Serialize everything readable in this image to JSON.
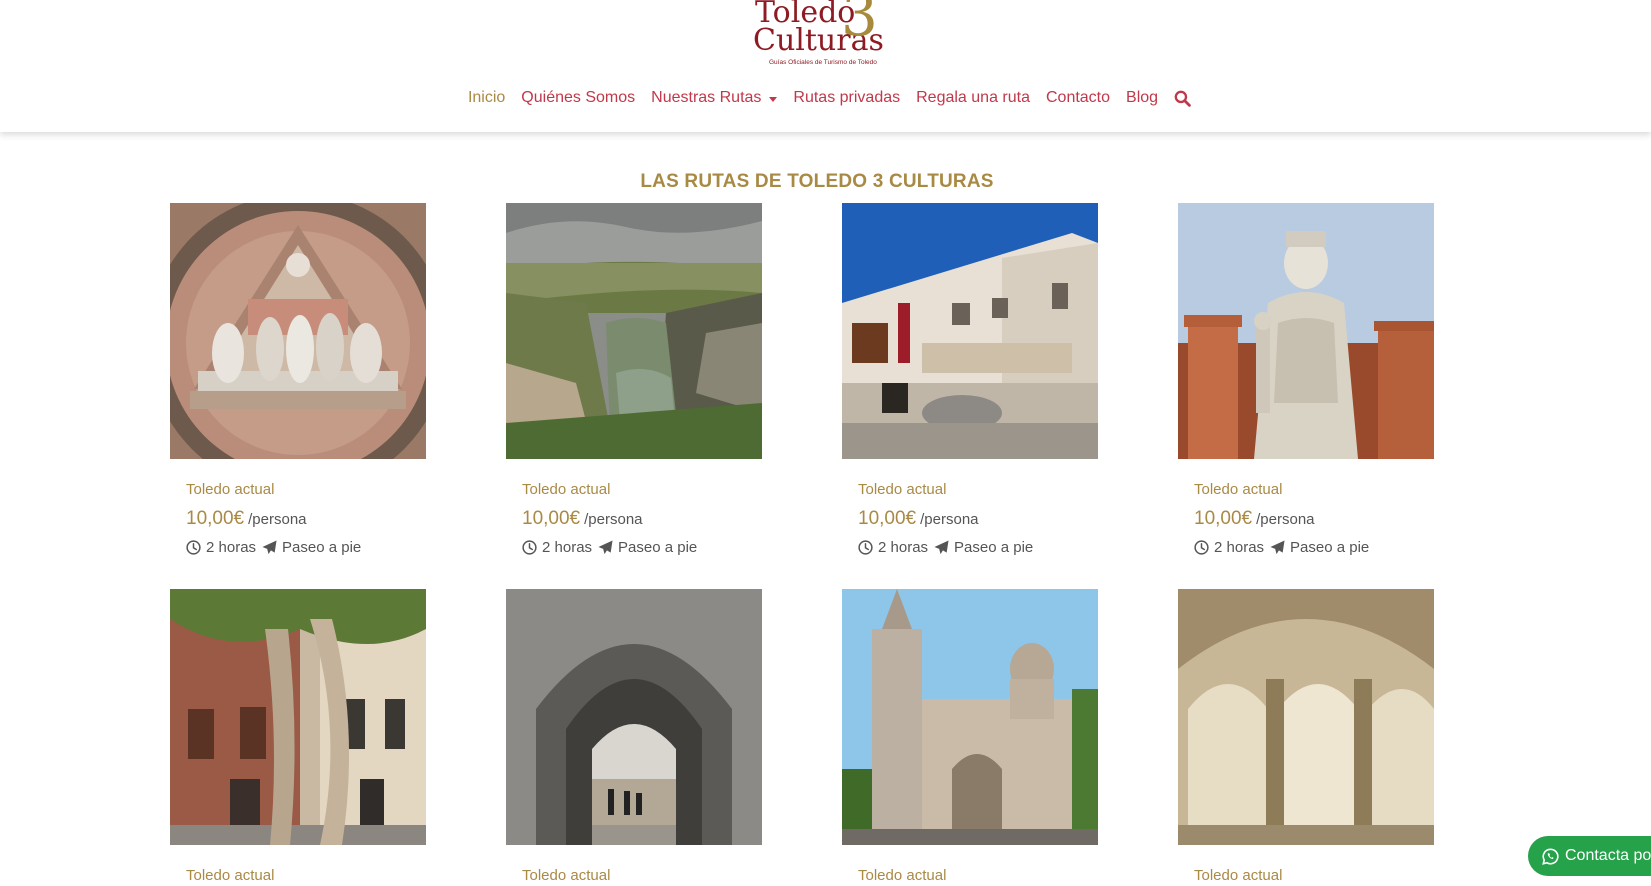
{
  "brand": {
    "line1": "Toledo",
    "line2": "Culturas",
    "number": "3",
    "tagline": "Guías Oficiales de Turismo de Toledo"
  },
  "nav": {
    "items": [
      {
        "label": "Inicio"
      },
      {
        "label": "Quiénes Somos"
      },
      {
        "label": "Nuestras Rutas"
      },
      {
        "label": "Rutas privadas"
      },
      {
        "label": "Regala una ruta"
      },
      {
        "label": "Contacto"
      },
      {
        "label": "Blog"
      }
    ],
    "search_icon": "search-icon"
  },
  "section": {
    "title": "LAS RUTAS DE TOLEDO 3 CULTURAS"
  },
  "cards": [
    {
      "category": "Toledo actual",
      "price": "10,00€",
      "per": "/persona",
      "duration": "2 horas",
      "mode": "Paseo a pie",
      "image": "relief-medallion"
    },
    {
      "category": "Toledo actual",
      "price": "10,00€",
      "per": "/persona",
      "duration": "2 horas",
      "mode": "Paseo a pie",
      "image": "river-gorge"
    },
    {
      "category": "Toledo actual",
      "price": "10,00€",
      "per": "/persona",
      "duration": "2 horas",
      "mode": "Paseo a pie",
      "image": "museum-building"
    },
    {
      "category": "Toledo actual",
      "price": "10,00€",
      "per": "/persona",
      "duration": "2 horas",
      "mode": "Paseo a pie",
      "image": "queen-statue"
    },
    {
      "category": "Toledo actual",
      "image": "plaza-trees"
    },
    {
      "category": "Toledo actual",
      "image": "stone-gate"
    },
    {
      "category": "Toledo actual",
      "image": "cathedral"
    },
    {
      "category": "Toledo actual",
      "image": "cloister"
    }
  ],
  "whatsapp": {
    "label": "Contacta por WhatsApp",
    "icon": "whatsapp-icon"
  },
  "colors": {
    "gold": "#a98a45",
    "red": "#c0394b",
    "whatsapp": "#25a24a"
  }
}
